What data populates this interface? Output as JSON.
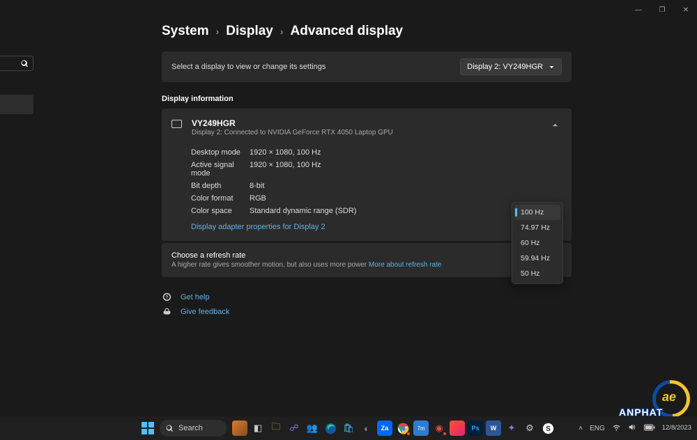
{
  "titlebar": {
    "min": "—",
    "max": "❐",
    "close": "✕"
  },
  "breadcrumb": {
    "a": "System",
    "b": "Display",
    "c": "Advanced display",
    "sep": "›"
  },
  "selectDisplay": {
    "label": "Select a display to view or change its settings",
    "value": "Display 2: VY249HGR"
  },
  "sectionTitle": "Display information",
  "info": {
    "model": "VY249HGR",
    "sub": "Display 2: Connected to NVIDIA GeForce RTX 4050 Laptop GPU",
    "rows": [
      {
        "k": "Desktop mode",
        "v": "1920 × 1080, 100 Hz"
      },
      {
        "k": "Active signal mode",
        "v": "1920 × 1080, 100 Hz"
      },
      {
        "k": "Bit depth",
        "v": "8-bit"
      },
      {
        "k": "Color format",
        "v": "RGB"
      },
      {
        "k": "Color space",
        "v": "Standard dynamic range (SDR)"
      }
    ],
    "adapterLink": "Display adapter properties for Display 2"
  },
  "refresh": {
    "title": "Choose a refresh rate",
    "sub": "A higher rate gives smoother motion, but also uses more power  ",
    "moreLink": "More about refresh rate",
    "options": [
      "100 Hz",
      "74.97 Hz",
      "60 Hz",
      "59.94 Hz",
      "50 Hz"
    ],
    "selected": "100 Hz"
  },
  "footer": {
    "help": "Get help",
    "feedback": "Give feedback"
  },
  "taskbar": {
    "search": "Search",
    "lang": "ENG",
    "time": "",
    "date": "12/8/2023"
  },
  "watermark": {
    "brand": "ANPHAT",
    "ae": "ae"
  }
}
